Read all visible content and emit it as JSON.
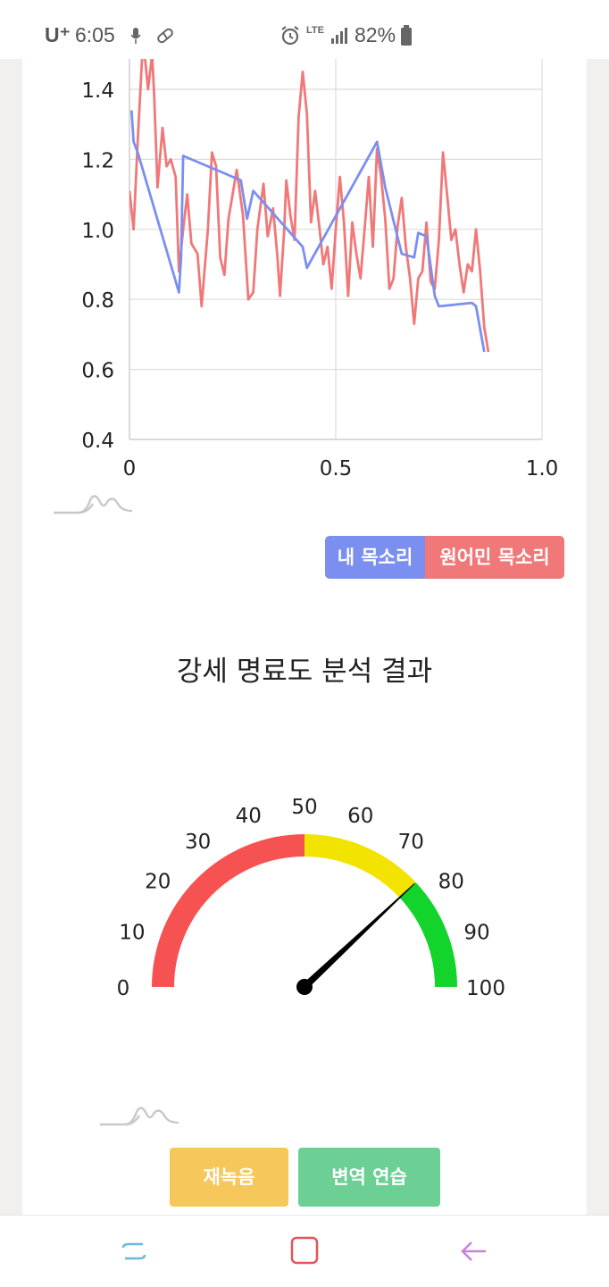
{
  "status_bar": {
    "carrier": "U⁺",
    "time": "6:05",
    "network": "LTE",
    "battery": "82%"
  },
  "chart_data": {
    "type": "line",
    "xlim": [
      0,
      1.0
    ],
    "ylim": [
      0.4,
      1.5
    ],
    "x_ticks": [
      "0",
      "0.5",
      "1.0"
    ],
    "y_ticks": [
      "0.4",
      "0.6",
      "0.8",
      "1.0",
      "1.2",
      "1.4"
    ],
    "grid": true,
    "series": [
      {
        "name": "내 목소리",
        "color": "#7b8ff0",
        "points": [
          [
            0.005,
            1.34
          ],
          [
            0.01,
            1.25
          ],
          [
            0.02,
            1.22
          ],
          [
            0.12,
            0.82
          ],
          [
            0.125,
            0.92
          ],
          [
            0.13,
            1.21
          ],
          [
            0.27,
            1.14
          ],
          [
            0.285,
            1.03
          ],
          [
            0.3,
            1.11
          ],
          [
            0.42,
            0.95
          ],
          [
            0.43,
            0.89
          ],
          [
            0.6,
            1.25
          ],
          [
            0.62,
            1.12
          ],
          [
            0.66,
            0.93
          ],
          [
            0.69,
            0.92
          ],
          [
            0.7,
            0.99
          ],
          [
            0.72,
            0.98
          ],
          [
            0.74,
            0.81
          ],
          [
            0.75,
            0.78
          ],
          [
            0.83,
            0.79
          ],
          [
            0.84,
            0.78
          ],
          [
            0.86,
            0.65
          ]
        ]
      },
      {
        "name": "원어민 목소리",
        "color": "#f07878",
        "points": [
          [
            0.0,
            1.11
          ],
          [
            0.01,
            1.0
          ],
          [
            0.02,
            1.25
          ],
          [
            0.03,
            1.48
          ],
          [
            0.035,
            1.52
          ],
          [
            0.045,
            1.4
          ],
          [
            0.055,
            1.5
          ],
          [
            0.06,
            1.38
          ],
          [
            0.068,
            1.12
          ],
          [
            0.08,
            1.29
          ],
          [
            0.09,
            1.18
          ],
          [
            0.1,
            1.2
          ],
          [
            0.112,
            1.15
          ],
          [
            0.12,
            0.88
          ],
          [
            0.13,
            1.0
          ],
          [
            0.14,
            1.1
          ],
          [
            0.15,
            0.96
          ],
          [
            0.165,
            0.93
          ],
          [
            0.175,
            0.78
          ],
          [
            0.19,
            1.0
          ],
          [
            0.2,
            1.22
          ],
          [
            0.21,
            1.18
          ],
          [
            0.22,
            0.92
          ],
          [
            0.23,
            0.87
          ],
          [
            0.24,
            1.03
          ],
          [
            0.25,
            1.1
          ],
          [
            0.26,
            1.17
          ],
          [
            0.275,
            1.04
          ],
          [
            0.288,
            0.8
          ],
          [
            0.3,
            0.82
          ],
          [
            0.31,
            1.0
          ],
          [
            0.325,
            1.13
          ],
          [
            0.335,
            0.98
          ],
          [
            0.348,
            1.06
          ],
          [
            0.358,
            0.93
          ],
          [
            0.365,
            0.81
          ],
          [
            0.375,
            1.0
          ],
          [
            0.38,
            1.14
          ],
          [
            0.39,
            1.04
          ],
          [
            0.4,
            0.97
          ],
          [
            0.41,
            1.32
          ],
          [
            0.42,
            1.45
          ],
          [
            0.43,
            1.33
          ],
          [
            0.44,
            1.02
          ],
          [
            0.45,
            1.11
          ],
          [
            0.46,
            1.01
          ],
          [
            0.47,
            0.9
          ],
          [
            0.48,
            0.95
          ],
          [
            0.49,
            0.83
          ],
          [
            0.5,
            1.0
          ],
          [
            0.51,
            1.15
          ],
          [
            0.52,
            1.02
          ],
          [
            0.53,
            0.81
          ],
          [
            0.54,
            1.02
          ],
          [
            0.55,
            0.93
          ],
          [
            0.56,
            0.86
          ],
          [
            0.57,
            1.0
          ],
          [
            0.58,
            1.15
          ],
          [
            0.59,
            0.95
          ],
          [
            0.6,
            1.23
          ],
          [
            0.61,
            1.15
          ],
          [
            0.62,
            1.03
          ],
          [
            0.63,
            0.83
          ],
          [
            0.64,
            0.86
          ],
          [
            0.65,
            1.01
          ],
          [
            0.66,
            1.09
          ],
          [
            0.67,
            0.95
          ],
          [
            0.68,
            0.86
          ],
          [
            0.69,
            0.73
          ],
          [
            0.7,
            0.86
          ],
          [
            0.71,
            0.88
          ],
          [
            0.72,
            1.02
          ],
          [
            0.73,
            0.85
          ],
          [
            0.74,
            0.83
          ],
          [
            0.75,
            0.97
          ],
          [
            0.76,
            1.22
          ],
          [
            0.77,
            1.1
          ],
          [
            0.78,
            0.97
          ],
          [
            0.79,
            1.0
          ],
          [
            0.8,
            0.9
          ],
          [
            0.81,
            0.82
          ],
          [
            0.82,
            0.9
          ],
          [
            0.83,
            0.88
          ],
          [
            0.84,
            1.0
          ],
          [
            0.85,
            0.88
          ],
          [
            0.86,
            0.72
          ],
          [
            0.87,
            0.65
          ]
        ]
      }
    ]
  },
  "legend": {
    "my_voice": "내 목소리",
    "native_voice": "원어민 목소리"
  },
  "gauge_section": {
    "title": "강세 명료도 분석 결과",
    "value": 76,
    "min": 0,
    "max": 100,
    "tick_labels": [
      "0",
      "10",
      "20",
      "30",
      "40",
      "50",
      "60",
      "70",
      "80",
      "90",
      "100"
    ],
    "bands": [
      {
        "from": 0,
        "to": 50,
        "color": "#f75252"
      },
      {
        "from": 50,
        "to": 76,
        "color": "#f2e300"
      },
      {
        "from": 76,
        "to": 100,
        "color": "#12d42b"
      }
    ]
  },
  "buttons": {
    "rerecord": "재녹음",
    "interpretation_practice": "변역 연습"
  }
}
